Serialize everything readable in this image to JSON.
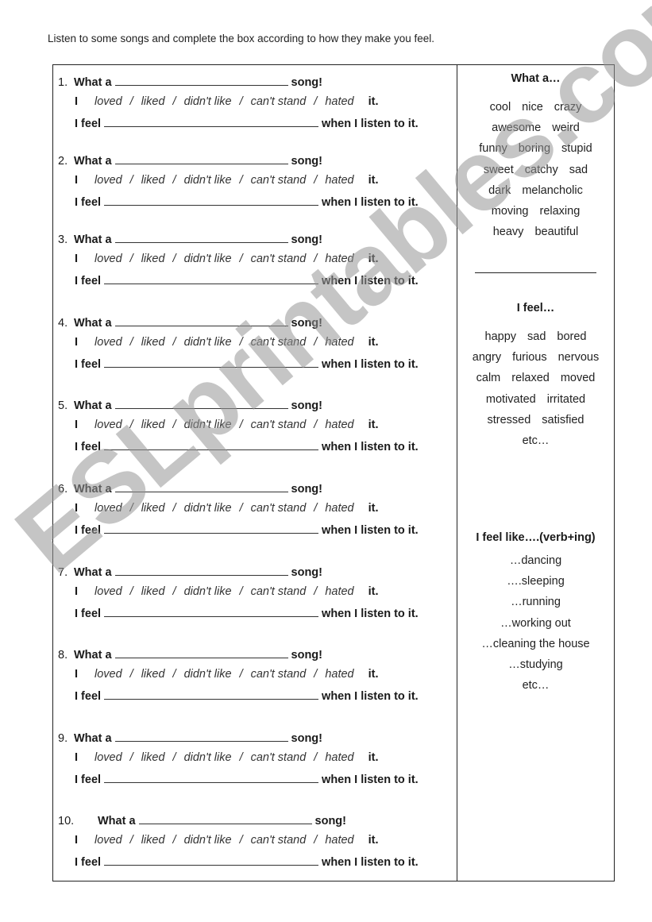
{
  "instructions": "Listen to some songs and complete the box according to how they make you feel.",
  "exercise": {
    "what_a": "What a",
    "song": "song!",
    "pronoun": "I",
    "options": [
      "loved",
      "liked",
      "didn't like",
      "can't stand",
      "hated"
    ],
    "separator": "/",
    "it": "it.",
    "i_feel": "I feel",
    "when_listen": "when I listen to it.",
    "items": [
      {
        "number": "1."
      },
      {
        "number": "2."
      },
      {
        "number": "3."
      },
      {
        "number": "4."
      },
      {
        "number": "5."
      },
      {
        "number": "6."
      },
      {
        "number": "7."
      },
      {
        "number": "8."
      },
      {
        "number": "9."
      },
      {
        "number": "10."
      }
    ]
  },
  "sidebar": {
    "what_a_heading": "What a…",
    "adjectives": [
      [
        "cool",
        "nice",
        "crazy"
      ],
      [
        "awesome",
        "weird"
      ],
      [
        "funny",
        "boring",
        "stupid"
      ],
      [
        "sweet",
        "catchy",
        "sad"
      ],
      [
        "dark",
        "melancholic"
      ],
      [
        "moving",
        "relaxing"
      ],
      [
        "heavy",
        "beautiful"
      ]
    ],
    "i_feel_heading": "I feel…",
    "feelings": [
      [
        "happy",
        "sad",
        "bored"
      ],
      [
        "angry",
        "furious",
        "nervous"
      ],
      [
        "calm",
        "relaxed",
        "moved"
      ],
      [
        "motivated",
        "irritated"
      ],
      [
        "stressed",
        "satisfied"
      ],
      [
        "etc…"
      ]
    ],
    "feel_like_heading": "I feel like….(verb+ing)",
    "activities": [
      "…dancing",
      "….sleeping",
      "…running",
      "…working out",
      "…cleaning the house",
      "…studying",
      "etc…"
    ]
  },
  "watermark": "ESLprintables.com"
}
